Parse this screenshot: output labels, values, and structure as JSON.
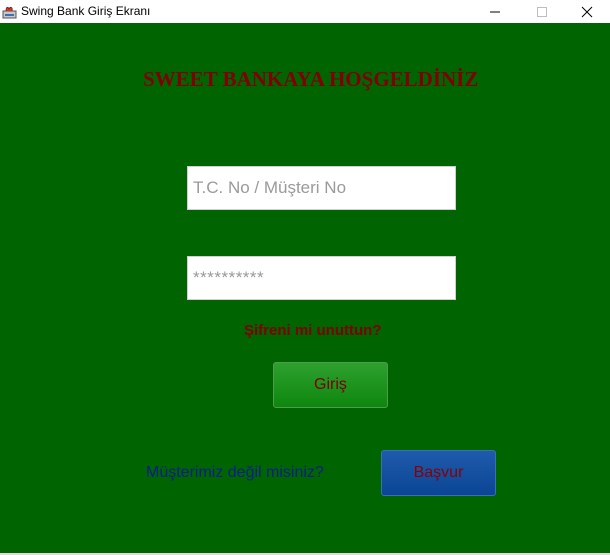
{
  "window": {
    "title": "Swing Bank Giriş Ekranı",
    "minimize_icon": "minimize-icon",
    "maximize_icon": "maximize-icon",
    "close_icon": "close-icon"
  },
  "colors": {
    "background": "#006400",
    "heading": "#800000",
    "link": "#0b1e8c",
    "login_button": "#169516",
    "apply_button": "#154f9f"
  },
  "main": {
    "welcome": "SWEET BANKAYA HOŞGELDİNİZ",
    "customer_field": {
      "placeholder": "T.C. No / Müşteri No",
      "value": ""
    },
    "password_field": {
      "placeholder": "**********",
      "value": ""
    },
    "forgot_password": "Şifreni mi unuttun?",
    "login_label": "Giriş",
    "not_customer_text": "Müşterimiz değil misiniz?",
    "apply_label": "Başvur"
  }
}
